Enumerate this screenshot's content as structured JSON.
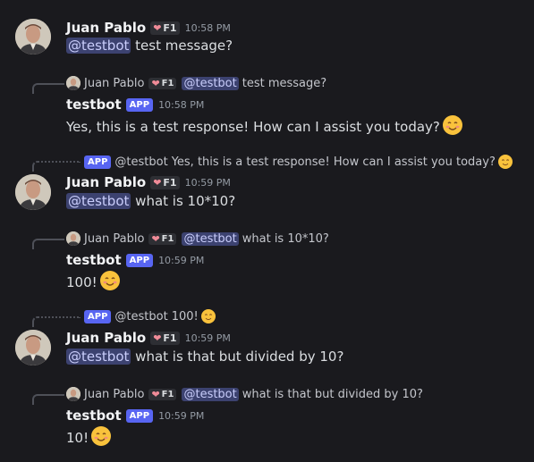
{
  "users": {
    "juan": {
      "name": "Juan Pablo",
      "badge": "F1"
    },
    "bot": {
      "name": "testbot",
      "app_tag": "APP"
    }
  },
  "messages": [
    {
      "author": "Juan Pablo",
      "badge": "F1",
      "time": "10:58 PM",
      "mention": "@testbot",
      "text": "test message?"
    },
    {
      "reply_to": {
        "author": "Juan Pablo",
        "badge": "F1",
        "mention": "@testbot",
        "text": "test message?"
      },
      "author": "testbot",
      "tag": "APP",
      "time": "10:58 PM",
      "text": "Yes, this is a test response! How can I assist you today?"
    },
    {
      "reply_to": {
        "tag": "APP",
        "author": "@testbot",
        "text": "Yes, this is a test response! How can I assist you today?"
      },
      "author": "Juan Pablo",
      "badge": "F1",
      "time": "10:59 PM",
      "mention": "@testbot",
      "text": "what is 10*10?"
    },
    {
      "reply_to": {
        "author": "Juan Pablo",
        "badge": "F1",
        "mention": "@testbot",
        "text": "what is 10*10?"
      },
      "author": "testbot",
      "tag": "APP",
      "time": "10:59 PM",
      "text": "100!"
    },
    {
      "reply_to": {
        "tag": "APP",
        "author": "@testbot",
        "text": "100!"
      },
      "author": "Juan Pablo",
      "badge": "F1",
      "time": "10:59 PM",
      "mention": "@testbot",
      "text": "what is that but divided by 10?"
    },
    {
      "reply_to": {
        "author": "Juan Pablo",
        "badge": "F1",
        "mention": "@testbot",
        "text": "what is that but divided by 10?"
      },
      "author": "testbot",
      "tag": "APP",
      "time": "10:59 PM",
      "text": "10!"
    }
  ],
  "icons": {
    "emoji": "smiling-face-emoji",
    "heart": "heart-icon"
  },
  "colors": {
    "background": "#1a1a1e",
    "mention_bg": "#3c4270",
    "app_badge": "#5865f2"
  }
}
